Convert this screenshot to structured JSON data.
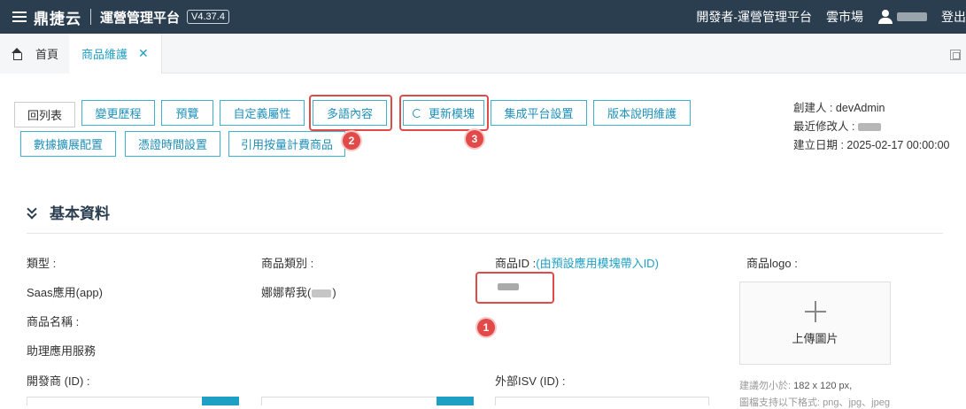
{
  "topbar": {
    "brand": "鼎捷云",
    "platform": "運營管理平台",
    "version": "V4.37.4",
    "right_items": [
      "開發者-運營管理平台",
      "雲市場"
    ],
    "logout": "登出"
  },
  "tabs": {
    "home": "首頁",
    "active": "商品維護",
    "close_glyph": "✕"
  },
  "toolbar": {
    "row1": [
      "回列表",
      "變更歷程",
      "預覽",
      "自定義屬性",
      "多語內容",
      "更新模塊",
      "集成平台設置",
      "版本說明維護"
    ],
    "row2": [
      "數據擴展配置",
      "憑證時間設置",
      "引用按量計費商品"
    ]
  },
  "annotations": [
    "1",
    "2",
    "3"
  ],
  "meta": {
    "creator_label": "創建人 : devAdmin",
    "modifier_label": "最近修改人 :",
    "created_date": "建立日期 : 2025-02-17 00:00:00"
  },
  "section": {
    "title": "基本資料"
  },
  "fields": {
    "type_label": "類型 :",
    "type_value": "Saas應用(app)",
    "category_label": "商品類別 :",
    "category_value": "娜娜帮我(",
    "category_suffix": ")",
    "product_id_label": "商品ID :",
    "product_id_hint": "(由預設應用模塊帶入ID)",
    "logo_label": "商品logo :",
    "name_label": "商品名稱 :",
    "name_value": "助理應用服務",
    "developer_label": "開發商 (ID) :",
    "external_isv_label": "外部ISV (ID) :"
  },
  "logo_upload": {
    "text": "上傳圖片",
    "hint1_prefix": "建議勿小於:",
    "hint1_value": "182 x 120 px,",
    "hint2": "圖檔支持以下格式: png、jpg、jpeg"
  },
  "colors": {
    "topbar": "#2b3e50",
    "accent": "#1e9fc4",
    "highlight": "#e24a4a"
  }
}
